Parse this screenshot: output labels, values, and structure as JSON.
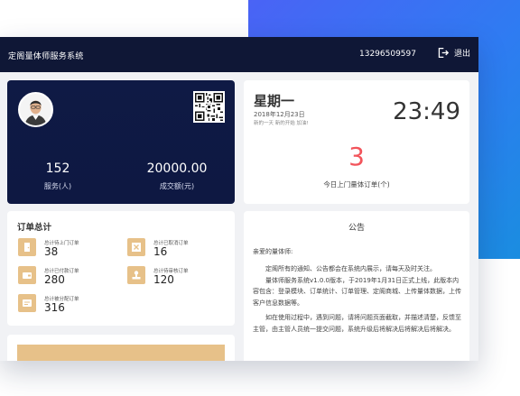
{
  "header": {
    "app_title": "定阁量体师服务系统",
    "phone": "13296509597",
    "logout_label": "退出"
  },
  "profile": {
    "service_count": "152",
    "service_label": "服务(人)",
    "amount": "20000.00",
    "amount_label": "成交额(元)"
  },
  "date_card": {
    "weekday": "星期一",
    "date": "2018年12月23日",
    "motto": "新的一天 新的开始 加油!",
    "time": "23:49",
    "today_orders": "3",
    "today_orders_label": "今日上门量体订单(个)"
  },
  "order_summary": {
    "title": "订单总计",
    "items": [
      {
        "label": "总计待上门订单",
        "value": "38",
        "icon": "door-icon"
      },
      {
        "label": "总计已取消订单",
        "value": "16",
        "icon": "cancel-icon"
      },
      {
        "label": "总计已付款订单",
        "value": "280",
        "icon": "wallet-icon"
      },
      {
        "label": "总计待审核订单",
        "value": "120",
        "icon": "stamp-icon"
      },
      {
        "label": "总计被分配订单",
        "value": "316",
        "icon": "assign-icon"
      }
    ]
  },
  "notice": {
    "title": "公告",
    "greeting": "亲爱的量体师:",
    "paragraphs": [
      "定阁所有的通知、公告都会在系统内展示，请每天及时关注。",
      "量体师服务系统v1.0.0版本，于2019年1月31日正式上线，此版本内容包含：登录模块、订单统计、订单管理、定阁商城、上传量体数据，上传客户信息数据等。",
      "如在使用过程中，遇到问题，请将问题页面截取，并描述清楚，反馈至主管，由主管人员统一提交问题，系统升级后将解决后将解决后将解决。"
    ]
  },
  "colors": {
    "topbar": "#0f1736",
    "accent_gold": "#e7c189",
    "orders_red": "#f2545b",
    "blue_bg": "#2f7bf2"
  }
}
